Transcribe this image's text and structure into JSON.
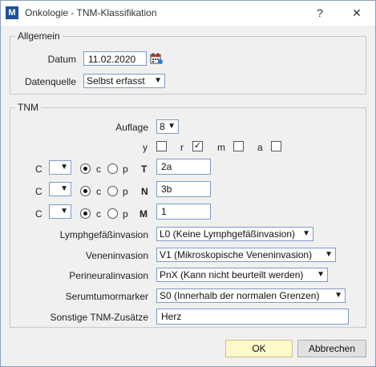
{
  "window": {
    "title": "Onkologie - TNM-Klassifikation",
    "help": "?",
    "close": "✕"
  },
  "allgemein": {
    "legend": "Allgemein",
    "datum_label": "Datum",
    "datum_value": "11.02.2020",
    "datenquelle_label": "Datenquelle",
    "datenquelle_value": "Selbst erfasst"
  },
  "tnm": {
    "legend": "TNM",
    "auflage_label": "Auflage",
    "auflage_value": "8",
    "flags": [
      {
        "label": "y",
        "checked": false
      },
      {
        "label": "r",
        "checked": true
      },
      {
        "label": "m",
        "checked": false
      },
      {
        "label": "a",
        "checked": false
      }
    ],
    "rows": [
      {
        "c_label": "C",
        "r1": "c",
        "r2": "p",
        "cat": "T",
        "value": "2a"
      },
      {
        "c_label": "C",
        "r1": "c",
        "r2": "p",
        "cat": "N",
        "value": "3b"
      },
      {
        "c_label": "C",
        "r1": "c",
        "r2": "p",
        "cat": "M",
        "value": "1"
      }
    ],
    "lymph_label": "Lymphgefäßinvasion",
    "lymph_value": "L0 (Keine Lymphgefäßinvasion)",
    "venen_label": "Veneninvasion",
    "venen_value": "V1 (Mikroskopische Veneninvasion)",
    "perineural_label": "Perineuralinvasion",
    "perineural_value": "PnX (Kann nicht beurteilt werden)",
    "serum_label": "Serumtumormarker",
    "serum_value": "S0 (Innerhalb der normalen Grenzen)",
    "sonstige_label": "Sonstige TNM-Zusätze",
    "sonstige_value": "Herz"
  },
  "buttons": {
    "ok": "OK",
    "cancel": "Abbrechen"
  },
  "colors": {
    "ok_bg": "#fff8c8",
    "field_border": "#7a9cc8",
    "app_icon": "#1f4e9a"
  }
}
